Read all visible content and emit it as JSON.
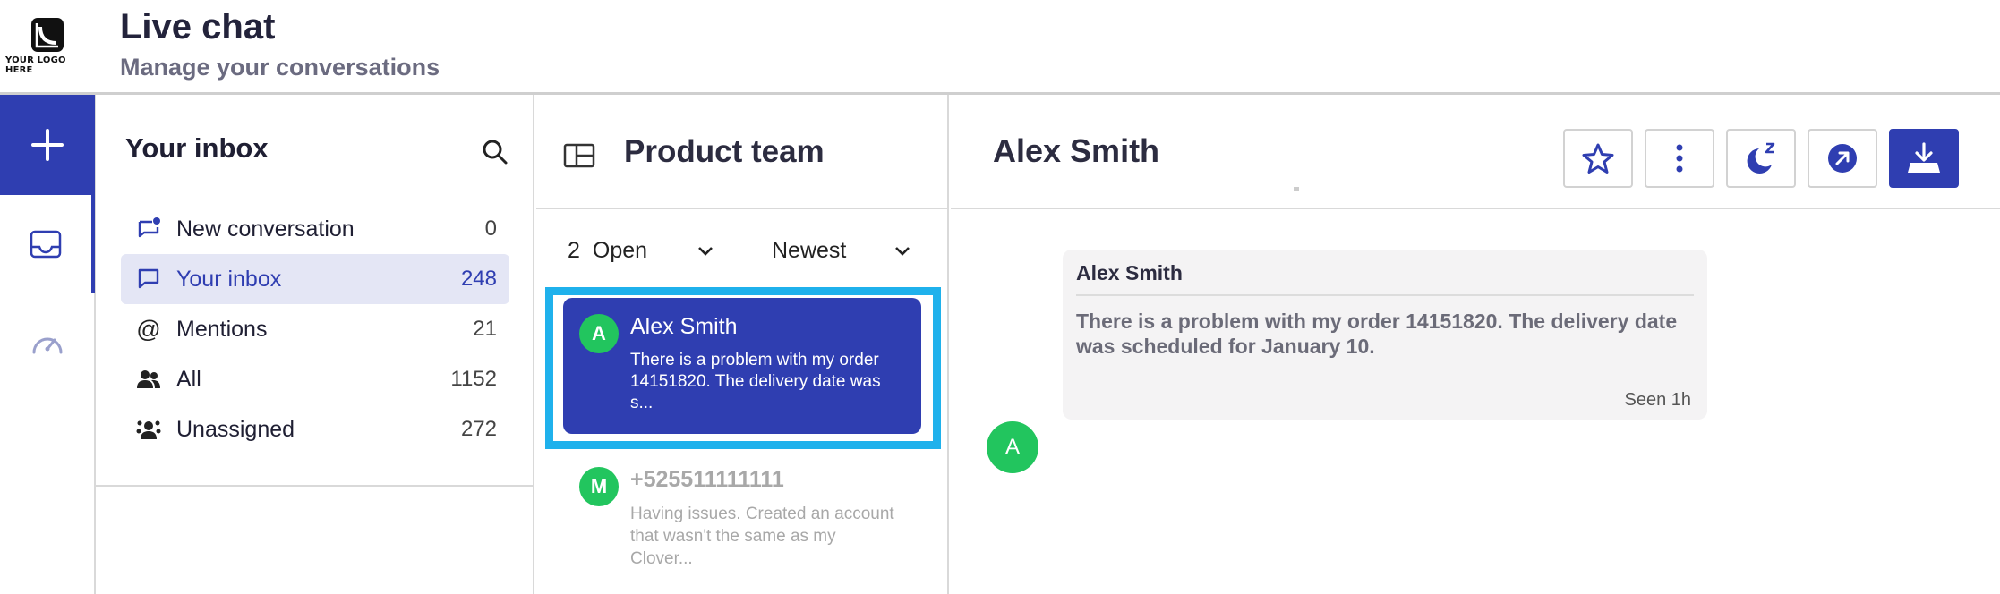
{
  "header": {
    "logo_text": "YOUR LOGO HERE",
    "title": "Live chat",
    "subtitle": "Manage your conversations"
  },
  "rail": {
    "new_icon": "plus-icon",
    "items": [
      {
        "icon": "inbox-tray-icon",
        "active": true
      },
      {
        "icon": "speedometer-icon",
        "active": false
      }
    ]
  },
  "inbox": {
    "title": "Your inbox",
    "items": [
      {
        "icon": "new-chat-icon",
        "label": "New conversation",
        "count": "0",
        "active": false
      },
      {
        "icon": "chat-icon",
        "label": "Your inbox",
        "count": "248",
        "active": true
      },
      {
        "icon": "at-icon",
        "label": "Mentions",
        "count": "21",
        "active": false
      },
      {
        "icon": "people-icon",
        "label": "All",
        "count": "1152",
        "active": false
      },
      {
        "icon": "unassigned-icon",
        "label": "Unassigned",
        "count": "272",
        "active": false
      }
    ]
  },
  "conversations": {
    "title": "Product team",
    "open_count": "2",
    "status_filter": "Open",
    "sort": "Newest",
    "items": [
      {
        "initial": "A",
        "name": "Alex Smith",
        "preview": "There is a problem with my order 14151820. The delivery date was s...",
        "selected": true
      },
      {
        "initial": "M",
        "name": "+525511111111",
        "preview": "Having issues. Created an account that wasn't the same as my Clover...",
        "selected": false
      }
    ]
  },
  "chat": {
    "contact_name": "Alex Smith",
    "actions": [
      "star-icon",
      "more-vertical-icon",
      "snooze-icon",
      "transfer-icon",
      "resolve-download-icon"
    ],
    "message": {
      "author": "Alex Smith",
      "text": "There is a problem with my order 14151820. The delivery date was scheduled for January 10.",
      "status": "Seen 1h",
      "avatar_initial": "A"
    }
  },
  "colors": {
    "accent": "#2f3eb1",
    "highlight": "#1fb1ec",
    "avatar": "#22c55e"
  }
}
